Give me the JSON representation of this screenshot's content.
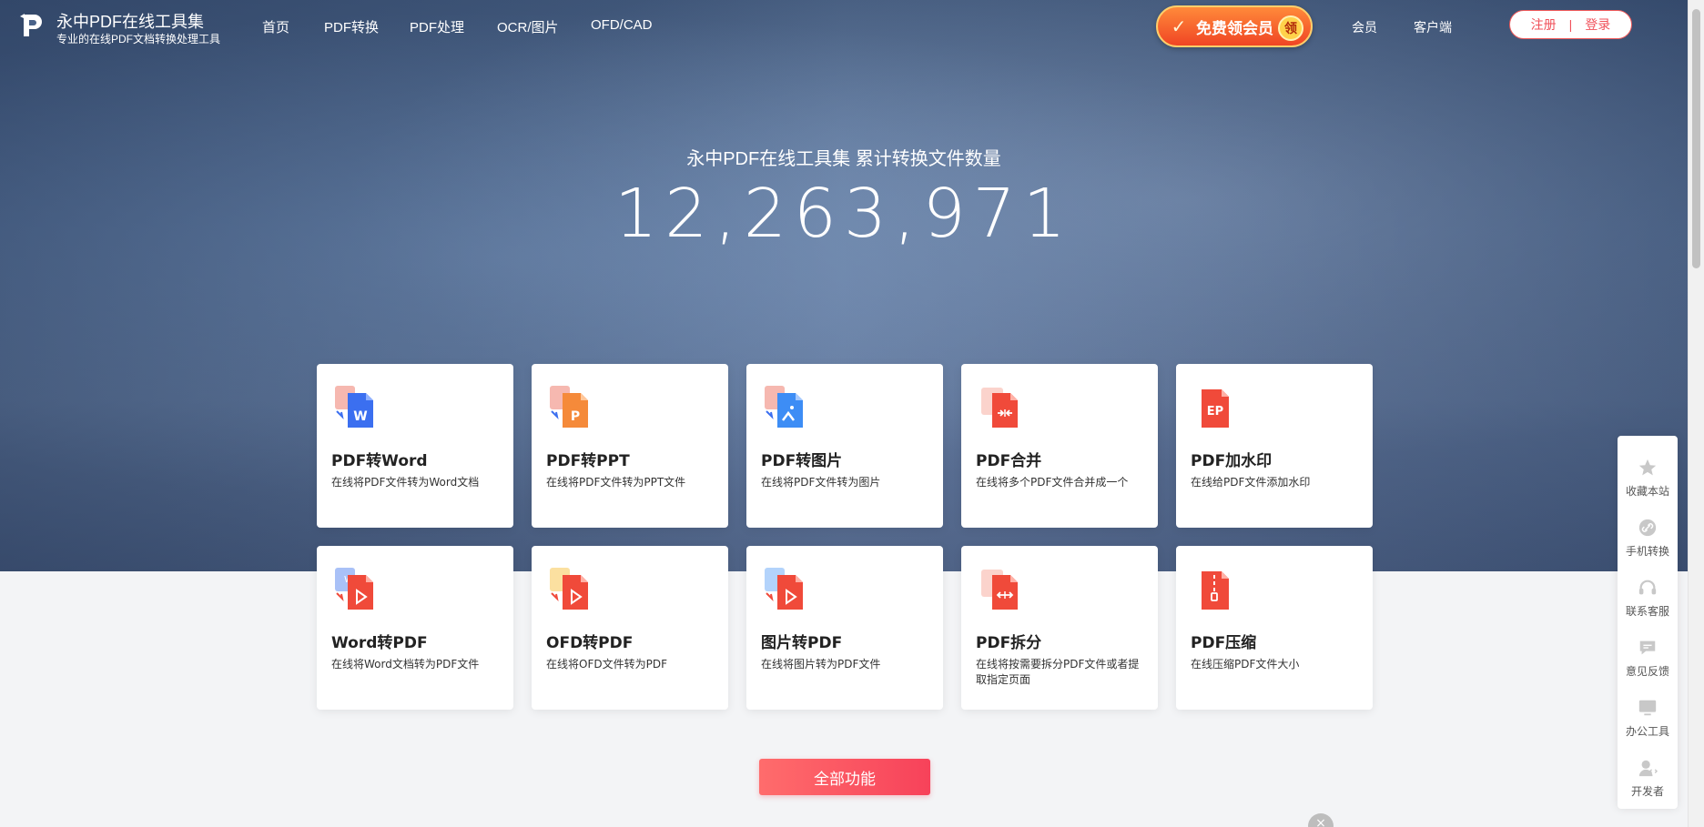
{
  "brand": {
    "title": "永中PDF在线工具集",
    "subtitle": "专业的在线PDF文档转换处理工具"
  },
  "nav": {
    "items": [
      "首页",
      "PDF转换",
      "PDF处理",
      "OCR/图片",
      "OFD/CAD"
    ],
    "vip_label": "免费领会员",
    "vip_badge": "领",
    "member": "会员",
    "client": "客户端",
    "register": "注册",
    "separator": "|",
    "login": "登录"
  },
  "hero": {
    "subtitle": "永中PDF在线工具集  累计转换文件数量",
    "count": "12,263,971"
  },
  "cards": [
    {
      "title": "PDF转Word",
      "desc": "在线将PDF文件转为Word文档",
      "icon": "pdf-to-word-icon",
      "color": "#3b6ff0"
    },
    {
      "title": "PDF转PPT",
      "desc": "在线将PDF文件转为PPT文件",
      "icon": "pdf-to-ppt-icon",
      "color": "#f58a3a"
    },
    {
      "title": "PDF转图片",
      "desc": "在线将PDF文件转为图片",
      "icon": "pdf-to-image-icon",
      "color": "#3d8df5"
    },
    {
      "title": "PDF合并",
      "desc": "在线将多个PDF文件合并成一个",
      "icon": "pdf-merge-icon",
      "color": "#f04a3a"
    },
    {
      "title": "PDF加水印",
      "desc": "在线给PDF文件添加水印",
      "icon": "pdf-watermark-icon",
      "color": "#f04a3a"
    },
    {
      "title": "Word转PDF",
      "desc": "在线将Word文档转为PDF文件",
      "icon": "word-to-pdf-icon",
      "color": "#f04a3a"
    },
    {
      "title": "OFD转PDF",
      "desc": "在线将OFD文件转为PDF",
      "icon": "ofd-to-pdf-icon",
      "color": "#f04a3a"
    },
    {
      "title": "图片转PDF",
      "desc": "在线将图片转为PDF文件",
      "icon": "image-to-pdf-icon",
      "color": "#f04a3a"
    },
    {
      "title": "PDF拆分",
      "desc": "在线将按需要拆分PDF文件或者提取指定页面",
      "icon": "pdf-split-icon",
      "color": "#f04a3a"
    },
    {
      "title": "PDF压缩",
      "desc": "在线压缩PDF文件大小",
      "icon": "pdf-compress-icon",
      "color": "#f04a3a"
    }
  ],
  "all_features": "全部功能",
  "sidebar": [
    {
      "label": "收藏本站",
      "icon": "star-icon"
    },
    {
      "label": "手机转换",
      "icon": "link-icon"
    },
    {
      "label": "联系客服",
      "icon": "headset-icon"
    },
    {
      "label": "意见反馈",
      "icon": "chat-icon"
    },
    {
      "label": "办公工具",
      "icon": "monitor-icon"
    },
    {
      "label": "开发者",
      "icon": "developer-icon"
    }
  ],
  "close_glyph": "×"
}
